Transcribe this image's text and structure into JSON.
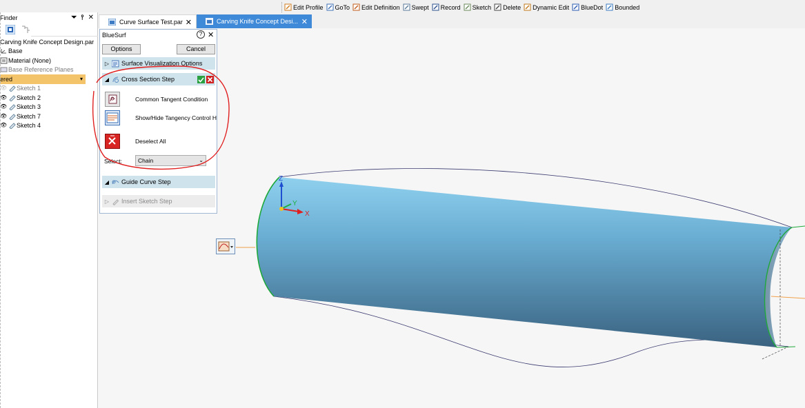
{
  "commands": [
    {
      "label": "Edit Profile",
      "icon": "edit-profile-icon",
      "color": "#d07a1a"
    },
    {
      "label": "GoTo",
      "icon": "goto-icon",
      "color": "#3c6fb5"
    },
    {
      "label": "Edit Definition",
      "icon": "edit-definition-icon",
      "color": "#c05a1a"
    },
    {
      "label": "Swept",
      "icon": "swept-icon",
      "color": "#5a7a9a"
    },
    {
      "label": "Record",
      "icon": "record-icon",
      "color": "#2a4f8a"
    },
    {
      "label": "Sketch",
      "icon": "sketch-icon",
      "color": "#6a8a5a"
    },
    {
      "label": "Delete",
      "icon": "delete-icon",
      "color": "#444444"
    },
    {
      "label": "Dynamic Edit",
      "icon": "dynamic-edit-icon",
      "color": "#c0781a"
    },
    {
      "label": "BlueDot",
      "icon": "bluedot-icon",
      "color": "#2a5ab0"
    },
    {
      "label": "Bounded",
      "icon": "bounded-icon",
      "color": "#3a7ac0"
    }
  ],
  "finder": {
    "title": "Finder",
    "tree": [
      {
        "label": "Carving Knife Concept Design.par",
        "icon": "",
        "muted": false
      },
      {
        "label": "Base",
        "icon": "coordinate-system-icon",
        "muted": false
      },
      {
        "label": "Material (None)",
        "icon": "material-icon",
        "muted": false
      },
      {
        "label": "Base Reference Planes",
        "icon": "reference-planes-icon",
        "muted": true
      },
      {
        "label": "ered",
        "icon": "",
        "muted": false,
        "ordered": true
      },
      {
        "label": "Sketch 1",
        "icon": "sketch-icon",
        "muted": true
      },
      {
        "label": "Sketch 2",
        "icon": "sketch-icon",
        "muted": false
      },
      {
        "label": "Sketch 3",
        "icon": "sketch-icon",
        "muted": false
      },
      {
        "label": "Sketch 7",
        "icon": "sketch-icon",
        "muted": false
      },
      {
        "label": "Sketch 4",
        "icon": "sketch-icon",
        "muted": false
      }
    ]
  },
  "tabs": [
    {
      "label": "Curve Surface Test.par",
      "active": false
    },
    {
      "label": "Carving Knife Concept Desi...",
      "active": true
    }
  ],
  "panel": {
    "title": "BlueSurf",
    "options_label": "Options",
    "cancel_label": "Cancel",
    "sections": {
      "surface_viz": "Surface Visualization Options",
      "cross_section": "Cross Section Step",
      "guide_curve": "Guide Curve Step",
      "insert_sketch": "Insert Sketch Step"
    },
    "items": [
      {
        "label": "Common Tangent Condition",
        "icon": "common-tangent-icon"
      },
      {
        "label": "Show/Hide Tangency Control H",
        "icon": "tangency-control-icon"
      },
      {
        "label": "Deselect All",
        "icon": "deselect-all-icon"
      }
    ],
    "select_label": "Select:",
    "select_value": "Chain"
  },
  "axes": {
    "z": "Z",
    "y": "Y",
    "x": "X"
  },
  "colors": {
    "accent_tab": "#3e8ad8",
    "surface_top": "#7cc6e8",
    "surface_bottom": "#3d6786",
    "annotation": "#e01e1e",
    "ordered_bar": "#f4c46a"
  }
}
